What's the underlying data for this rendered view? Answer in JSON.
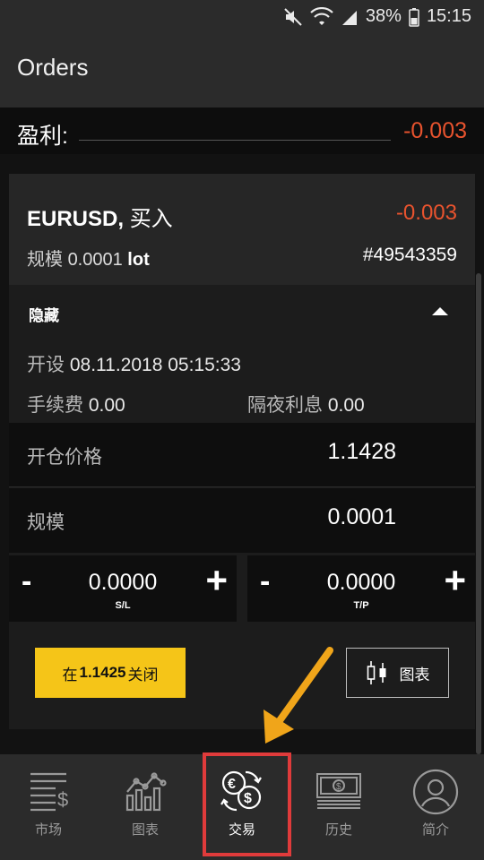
{
  "status_bar": {
    "battery": "38%",
    "time": "15:15"
  },
  "app_bar": {
    "title": "Orders"
  },
  "profit": {
    "label": "盈利:",
    "value": "-0.003"
  },
  "order": {
    "symbol": "EURUSD,",
    "side": "买入",
    "pl": "-0.003",
    "size_label": "规模",
    "size_value": "0.0001",
    "size_unit": "lot",
    "ticket": "#49543359",
    "hide_label": "隐藏",
    "open_label": "开设",
    "open_time": "08.11.2018 05:15:33",
    "commission_label": "手续费",
    "commission_value": "0.00",
    "swap_label": "隔夜利息",
    "swap_value": "0.00",
    "open_price_label": "开仓价格",
    "open_price_value": "1.1428",
    "volume_label": "规模",
    "volume_value": "0.0001",
    "sl": {
      "minus": "-",
      "value": "0.0000",
      "plus": "+",
      "caption": "S/L"
    },
    "tp": {
      "minus": "-",
      "value": "0.0000",
      "plus": "+",
      "caption": "T/P"
    },
    "close_button": {
      "prefix": "在",
      "price": "1.1425",
      "suffix": "关闭"
    },
    "chart_button": {
      "label": "图表"
    }
  },
  "nav": {
    "items": [
      {
        "label": "市场",
        "icon": "market-icon"
      },
      {
        "label": "图表",
        "icon": "chart-icon"
      },
      {
        "label": "交易",
        "icon": "trade-currency-icon"
      },
      {
        "label": "历史",
        "icon": "history-banknote-icon"
      },
      {
        "label": "简介",
        "icon": "profile-icon"
      }
    ],
    "active_index": 2
  },
  "colors": {
    "negative": "#e8532e",
    "accent_yellow": "#f5c518",
    "highlight_red": "#e03b3b",
    "arrow_orange": "#f0a51a"
  }
}
